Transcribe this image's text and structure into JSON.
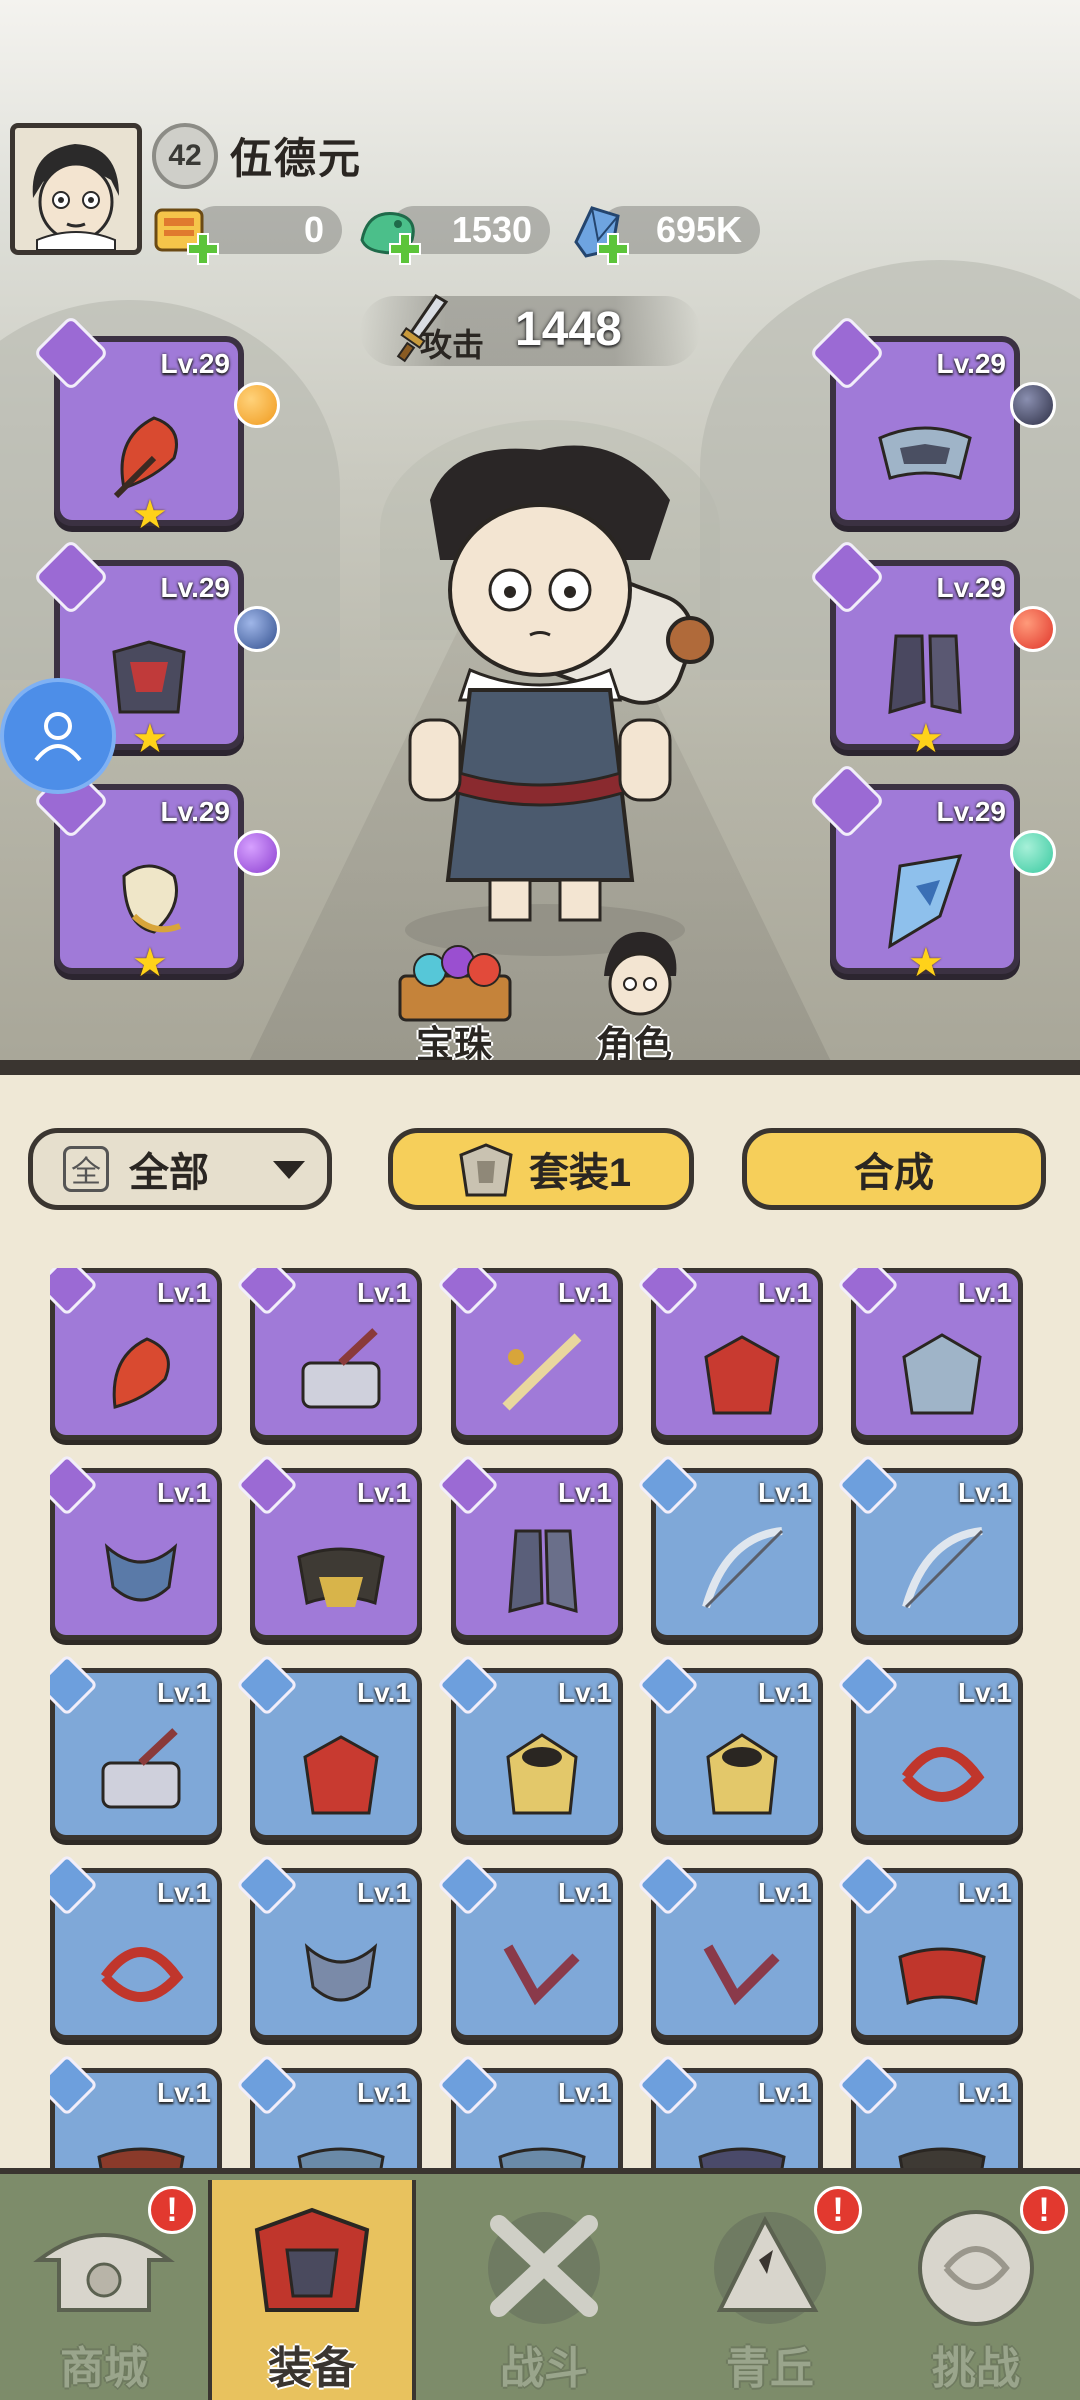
{
  "player": {
    "name": "伍德元",
    "level": "42"
  },
  "resources": [
    {
      "name": "scroll",
      "value": "0"
    },
    {
      "name": "jade",
      "value": "1530"
    },
    {
      "name": "crystal",
      "value": "695K"
    }
  ],
  "attack": {
    "label": "攻击",
    "value": "1448"
  },
  "equipped": {
    "left": [
      {
        "level": "Lv.29",
        "gem_color": "#f09a1e",
        "stars": "★"
      },
      {
        "level": "Lv.29",
        "gem_color": "#33508e",
        "stars": "★"
      },
      {
        "level": "Lv.29",
        "gem_color": "#8c3fd0",
        "stars": "★"
      }
    ],
    "right": [
      {
        "level": "Lv.29",
        "gem_color": "#2d2f45",
        "stars": ""
      },
      {
        "level": "Lv.29",
        "gem_color": "#e0352a",
        "stars": "★"
      },
      {
        "level": "Lv.29",
        "gem_color": "#39c9a0",
        "stars": "★"
      }
    ]
  },
  "hero_actions": {
    "gems": "宝珠",
    "character": "角色"
  },
  "filters": {
    "all_icon": "全",
    "all_label": "全部",
    "set_label": "套装1",
    "craft_label": "合成"
  },
  "inventory": [
    {
      "level": "Lv.1",
      "rarity": "purple"
    },
    {
      "level": "Lv.1",
      "rarity": "purple"
    },
    {
      "level": "Lv.1",
      "rarity": "purple"
    },
    {
      "level": "Lv.1",
      "rarity": "purple"
    },
    {
      "level": "Lv.1",
      "rarity": "purple"
    },
    {
      "level": "Lv.1",
      "rarity": "purple"
    },
    {
      "level": "Lv.1",
      "rarity": "purple"
    },
    {
      "level": "Lv.1",
      "rarity": "purple"
    },
    {
      "level": "Lv.1",
      "rarity": "blue"
    },
    {
      "level": "Lv.1",
      "rarity": "blue"
    },
    {
      "level": "Lv.1",
      "rarity": "blue"
    },
    {
      "level": "Lv.1",
      "rarity": "blue"
    },
    {
      "level": "Lv.1",
      "rarity": "blue"
    },
    {
      "level": "Lv.1",
      "rarity": "blue"
    },
    {
      "level": "Lv.1",
      "rarity": "blue"
    },
    {
      "level": "Lv.1",
      "rarity": "blue"
    },
    {
      "level": "Lv.1",
      "rarity": "blue"
    },
    {
      "level": "Lv.1",
      "rarity": "blue"
    },
    {
      "level": "Lv.1",
      "rarity": "blue"
    },
    {
      "level": "Lv.1",
      "rarity": "blue"
    },
    {
      "level": "Lv.1",
      "rarity": "blue"
    },
    {
      "level": "Lv.1",
      "rarity": "blue"
    },
    {
      "level": "Lv.1",
      "rarity": "blue"
    },
    {
      "level": "Lv.1",
      "rarity": "blue"
    },
    {
      "level": "Lv.1",
      "rarity": "blue"
    }
  ],
  "nav": [
    {
      "label": "商城",
      "badge": "!"
    },
    {
      "label": "装备",
      "badge": ""
    },
    {
      "label": "战斗",
      "badge": ""
    },
    {
      "label": "青丘",
      "badge": "!"
    },
    {
      "label": "挑战",
      "badge": "!"
    }
  ]
}
